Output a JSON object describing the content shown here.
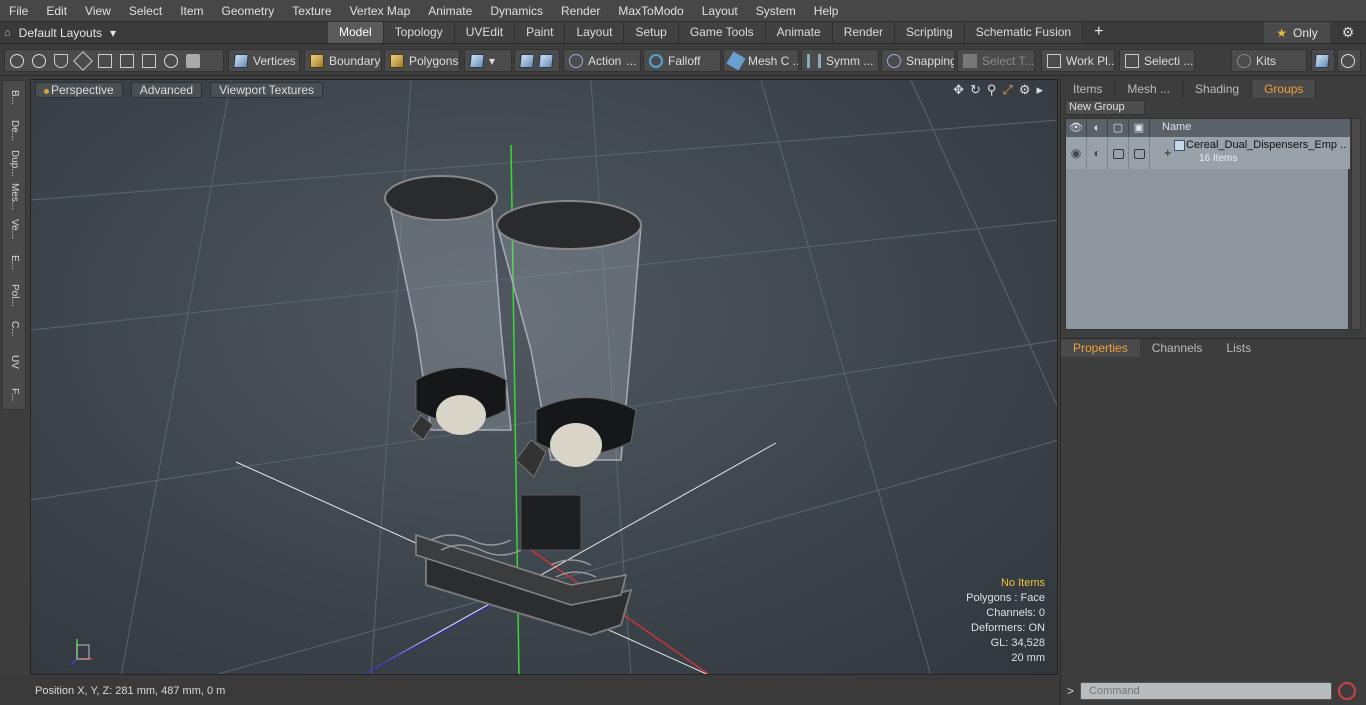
{
  "menu": [
    "File",
    "Edit",
    "View",
    "Select",
    "Item",
    "Geometry",
    "Texture",
    "Vertex Map",
    "Animate",
    "Dynamics",
    "Render",
    "MaxToModo",
    "Layout",
    "System",
    "Help"
  ],
  "layouts": {
    "label": "Default Layouts"
  },
  "tabs": [
    {
      "label": "Model",
      "active": true
    },
    {
      "label": "Topology"
    },
    {
      "label": "UVEdit"
    },
    {
      "label": "Paint"
    },
    {
      "label": "Layout"
    },
    {
      "label": "Setup"
    },
    {
      "label": "Game Tools"
    },
    {
      "label": "Animate"
    },
    {
      "label": "Render"
    },
    {
      "label": "Scripting"
    },
    {
      "label": "Schematic Fusion"
    }
  ],
  "only": {
    "label": "Only"
  },
  "toolbar": {
    "vertices": "Vertices",
    "boundary": "Boundary",
    "polygons": "Polygons",
    "action": "Action",
    "falloff": "Falloff",
    "mesh": "Mesh C ...",
    "symm": "Symm ...",
    "snapping": "Snapping",
    "select_t": "Select T...",
    "workpl": "Work Pl...",
    "selecti": "Selecti ...",
    "kits": "Kits"
  },
  "lefttabs": [
    "B...",
    "De...",
    "Dup...",
    "Mes...",
    "Ve...",
    "E...",
    "Pol...",
    "C...",
    "UV",
    "F..."
  ],
  "viewport": {
    "perspective": "Perspective",
    "advanced": "Advanced",
    "textures": "Viewport Textures"
  },
  "info": {
    "items": "No Items",
    "polygons": "Polygons : Face",
    "channels": "Channels: 0",
    "deformers": "Deformers: ON",
    "gl": "GL: 34,528",
    "scale": "20 mm"
  },
  "status": {
    "position": "Position X, Y, Z:  281 mm, 487 mm, 0 m"
  },
  "right": {
    "tabs": [
      {
        "label": "Items"
      },
      {
        "label": "Mesh ..."
      },
      {
        "label": "Shading"
      },
      {
        "label": "Groups",
        "active": true
      }
    ],
    "new_group": "New Group",
    "col_name": "Name",
    "group": {
      "name": "Cereal_Dual_Dispensers_Emp ...",
      "count": "16 Items"
    },
    "ptabs": [
      {
        "label": "Properties",
        "active": true
      },
      {
        "label": "Channels"
      },
      {
        "label": "Lists"
      }
    ],
    "command_placeholder": "Command"
  },
  "colors": {
    "accent": "#f0a040",
    "viewport_bg": "#3d454c",
    "green_axis": "#33cc33",
    "red_axis": "#cc3333",
    "blue_axis": "#3333aa"
  }
}
